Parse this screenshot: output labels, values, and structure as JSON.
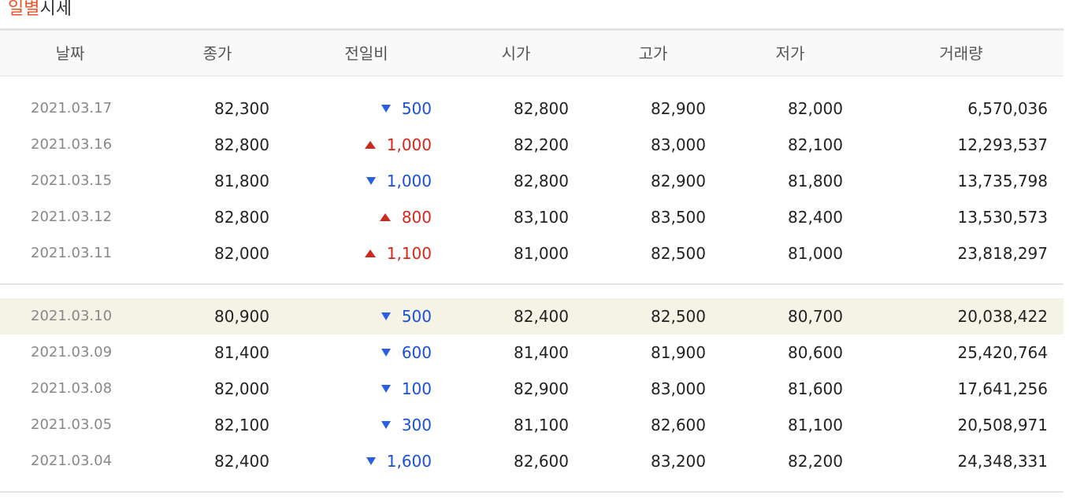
{
  "title": {
    "accent": "일별",
    "rest": "시세"
  },
  "headers": [
    "날짜",
    "종가",
    "전일비",
    "시가",
    "고가",
    "저가",
    "거래량"
  ],
  "colors": {
    "accent": "#e8542b",
    "up": "#d9261c",
    "down": "#1a50d6",
    "highlight_row": "#f5f3e6"
  },
  "rows": [
    {
      "date": "2021.03.17",
      "close": "82,300",
      "direction": "down",
      "diff": "500",
      "open": "82,800",
      "high": "82,900",
      "low": "82,000",
      "volume": "6,570,036"
    },
    {
      "date": "2021.03.16",
      "close": "82,800",
      "direction": "up",
      "diff": "1,000",
      "open": "82,200",
      "high": "83,000",
      "low": "82,100",
      "volume": "12,293,537"
    },
    {
      "date": "2021.03.15",
      "close": "81,800",
      "direction": "down",
      "diff": "1,000",
      "open": "82,800",
      "high": "82,900",
      "low": "81,800",
      "volume": "13,735,798"
    },
    {
      "date": "2021.03.12",
      "close": "82,800",
      "direction": "up",
      "diff": "800",
      "open": "83,100",
      "high": "83,500",
      "low": "82,400",
      "volume": "13,530,573"
    },
    {
      "date": "2021.03.11",
      "close": "82,000",
      "direction": "up",
      "diff": "1,100",
      "open": "81,000",
      "high": "82,500",
      "low": "81,000",
      "volume": "23,818,297"
    },
    {
      "date": "2021.03.10",
      "close": "80,900",
      "direction": "down",
      "diff": "500",
      "open": "82,400",
      "high": "82,500",
      "low": "80,700",
      "volume": "20,038,422",
      "highlighted": true
    },
    {
      "date": "2021.03.09",
      "close": "81,400",
      "direction": "down",
      "diff": "600",
      "open": "81,400",
      "high": "81,900",
      "low": "80,600",
      "volume": "25,420,764"
    },
    {
      "date": "2021.03.08",
      "close": "82,000",
      "direction": "down",
      "diff": "100",
      "open": "82,900",
      "high": "83,000",
      "low": "81,600",
      "volume": "17,641,256"
    },
    {
      "date": "2021.03.05",
      "close": "82,100",
      "direction": "down",
      "diff": "300",
      "open": "81,100",
      "high": "82,600",
      "low": "81,100",
      "volume": "20,508,971"
    },
    {
      "date": "2021.03.04",
      "close": "82,400",
      "direction": "down",
      "diff": "1,600",
      "open": "82,600",
      "high": "83,200",
      "low": "82,200",
      "volume": "24,348,331"
    }
  ]
}
